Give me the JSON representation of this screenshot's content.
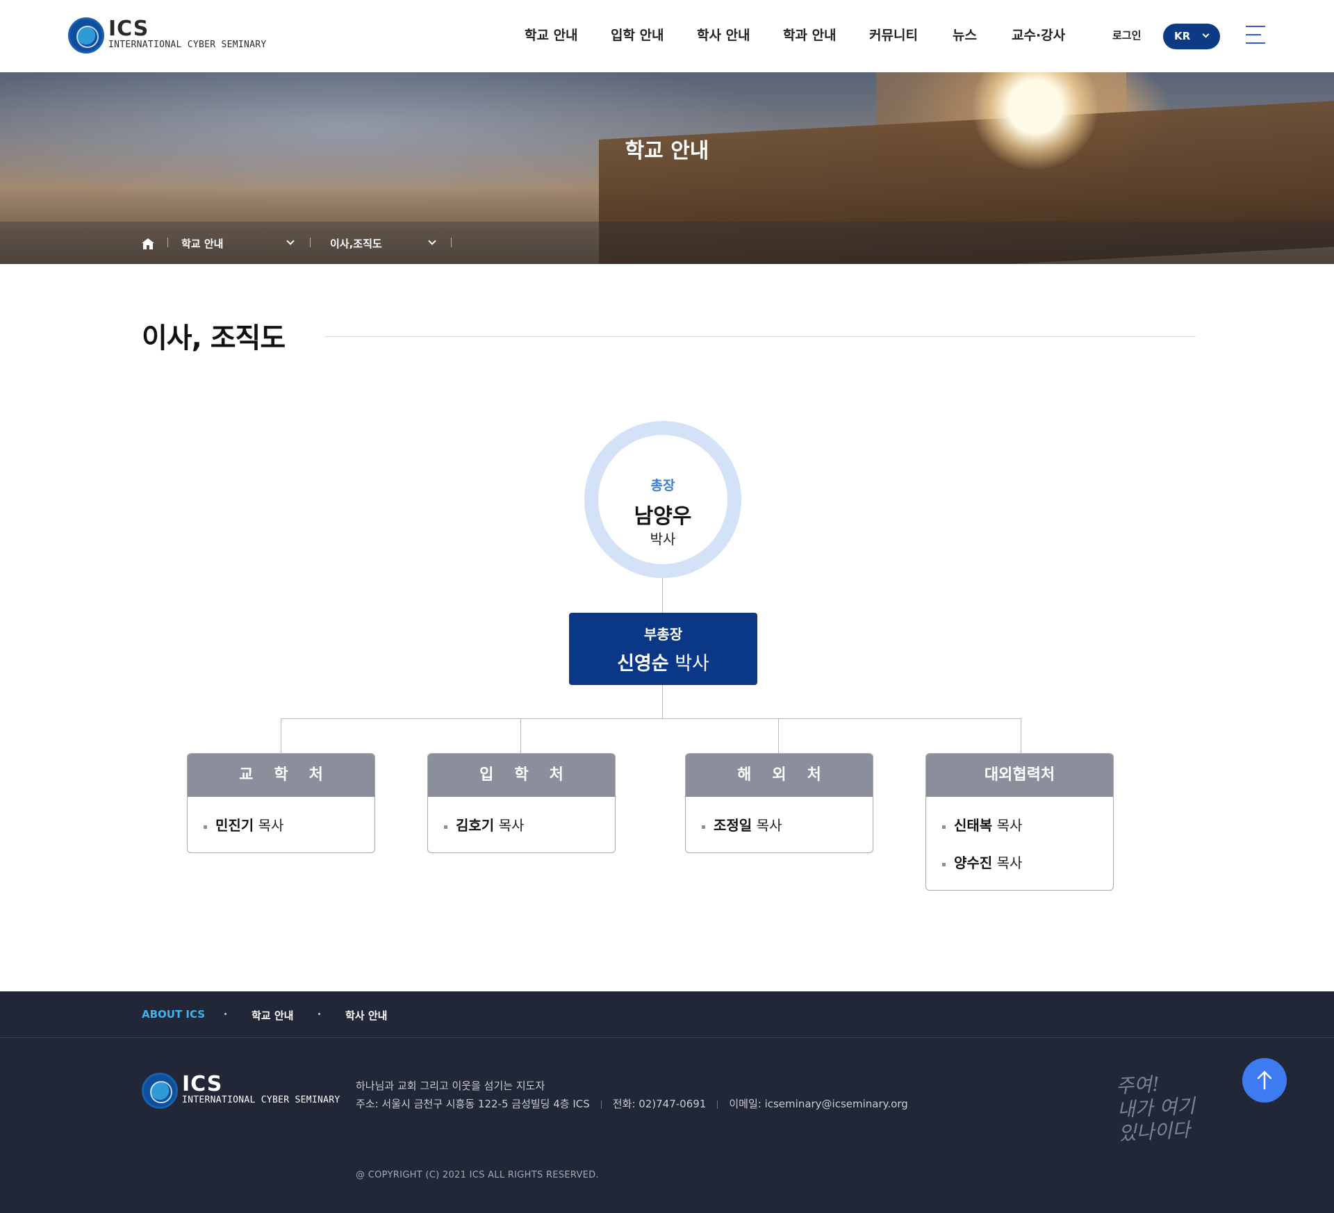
{
  "brand": {
    "name": "ICS",
    "subtitle": "INTERNATIONAL CYBER SEMINARY"
  },
  "gnb": {
    "items": [
      "학교 안내",
      "입학 안내",
      "학사 안내",
      "학과 안내",
      "커뮤니티",
      "뉴스",
      "교수·강사"
    ],
    "login": "로그인",
    "language": "KR"
  },
  "hero": {
    "title": "학교 안내",
    "breadcrumb": {
      "depth1": "학교 안내",
      "depth2": "이사,조직도"
    }
  },
  "page": {
    "title": "이사, 조직도"
  },
  "org": {
    "president": {
      "role": "총장",
      "name": "남양우",
      "title": "박사"
    },
    "vice_president": {
      "role": "부총장",
      "name": "신영순",
      "title": "박사"
    },
    "departments": [
      {
        "name": "교학처",
        "members": [
          {
            "name": "민진기",
            "title": "목사"
          }
        ]
      },
      {
        "name": "입학처",
        "members": [
          {
            "name": "김호기",
            "title": "목사"
          }
        ]
      },
      {
        "name": "해외처",
        "members": [
          {
            "name": "조정일",
            "title": "목사"
          }
        ]
      },
      {
        "name": "대외협력처",
        "members": [
          {
            "name": "신태복",
            "title": "목사"
          },
          {
            "name": "양수진",
            "title": "목사"
          }
        ]
      }
    ]
  },
  "footer": {
    "nav": [
      "ABOUT ICS",
      "학교 안내",
      "학사 안내"
    ],
    "tagline": "하나님과 교회 그리고 이웃을 섬기는 지도자",
    "address": "주소: 서울시 금천구 시흥동 122-5 금성빌딩 4층 ICS",
    "phone": "전화: 02)747-0691",
    "email": "이메일: icseminary@icseminary.org",
    "copyright": "@ COPYRIGHT (C) 2021 ICS ALL RIGHTS RESERVED.",
    "slogan": "주여!\n내가 여기\n있나이다"
  },
  "colors": {
    "navy": "#0b3886",
    "accent_blue": "#3b7fd0",
    "dept_header": "#8b8f9c",
    "footer_bg": "#212737",
    "top_button": "#3f7bf0"
  }
}
